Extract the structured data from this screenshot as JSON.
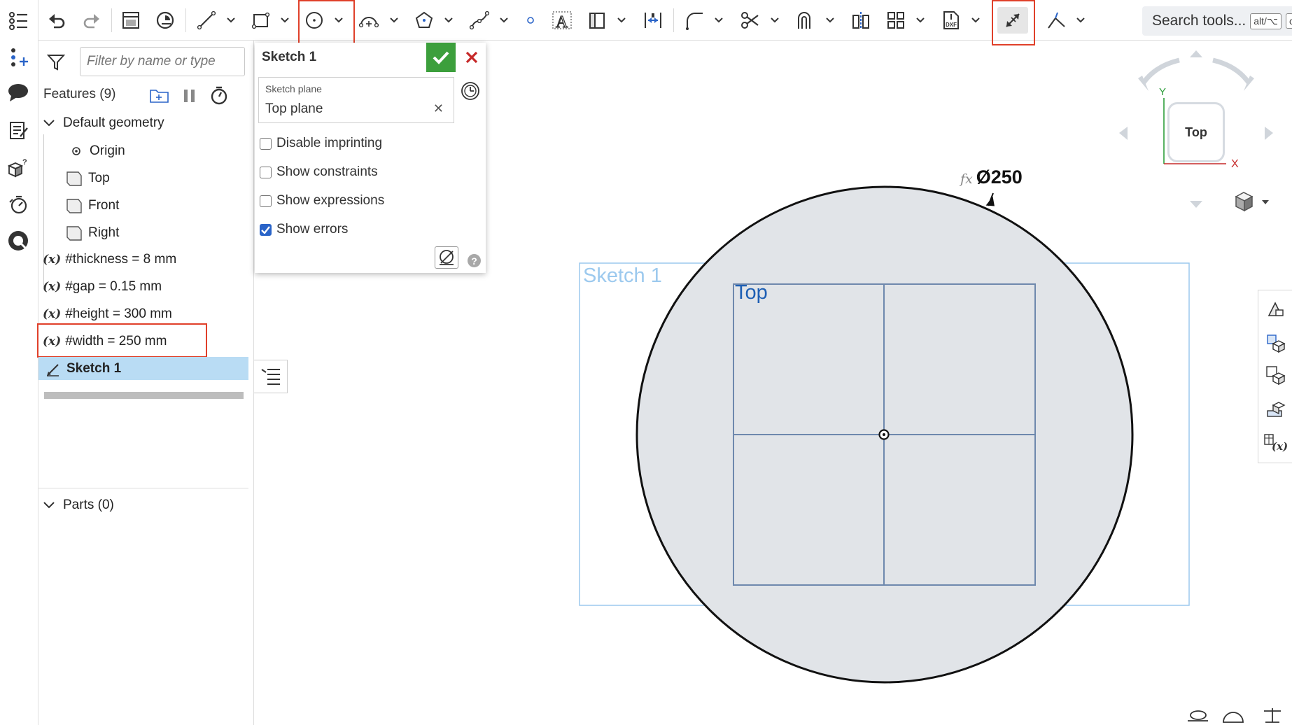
{
  "toolbar": {
    "search_label": "Search tools...",
    "search_shortcut_1": "alt/⌥",
    "search_shortcut_2": "c"
  },
  "feature_panel": {
    "filter_placeholder": "Filter by name or type",
    "title": "Features (9)",
    "tree": {
      "default_geometry": "Default geometry",
      "origin": "Origin",
      "top": "Top",
      "front": "Front",
      "right": "Right",
      "var_symbol": "(x)",
      "thickness": "#thickness = 8 mm",
      "gap": "#gap = 0.15 mm",
      "height": "#height = 300 mm",
      "width": "#width = 250 mm",
      "sketch": "Sketch 1"
    },
    "parts": "Parts (0)"
  },
  "sketch_dialog": {
    "title": "Sketch 1",
    "plane_label": "Sketch plane",
    "plane_value": "Top plane",
    "options": [
      {
        "label": "Disable imprinting",
        "checked": false
      },
      {
        "label": "Show constraints",
        "checked": false
      },
      {
        "label": "Show expressions",
        "checked": false
      },
      {
        "label": "Show errors",
        "checked": true
      }
    ]
  },
  "viewport": {
    "sketch_label": "Sketch 1",
    "plane_label": "Top",
    "dimension_prefix": "fx",
    "dimension": "Ø250",
    "view_cube_face": "Top",
    "axis_x": "X",
    "axis_y": "Y"
  },
  "colors": {
    "accent_highlight": "#e0402a",
    "confirm_green": "#3c9f3c",
    "cancel_red": "#c62828",
    "selection_blue": "#b9dcf4",
    "sketch_blue": "#1e5fb4"
  }
}
